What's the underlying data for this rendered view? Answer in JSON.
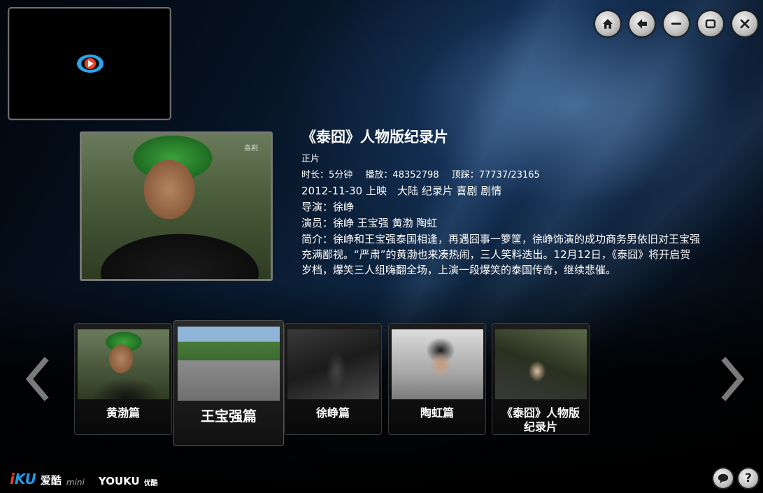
{
  "window": {
    "controls": [
      {
        "name": "home-button",
        "icon": "home-icon"
      },
      {
        "name": "back-button",
        "icon": "back-arrow-icon"
      },
      {
        "name": "minimize-button",
        "icon": "minimize-icon"
      },
      {
        "name": "maximize-button",
        "icon": "maximize-icon"
      },
      {
        "name": "close-button",
        "icon": "close-icon"
      }
    ]
  },
  "mini_player": {
    "icon": "youku-play-logo-icon"
  },
  "poster": {
    "stamp": "喜剧"
  },
  "detail": {
    "title": "《泰囧》人物版纪录片",
    "category": "正片",
    "duration": "时长：5分钟",
    "plays": "播放：48352798",
    "votes": "顶踩：77737/23165",
    "release_line": "2012-11-30 上映　大陆 纪录片 喜剧 剧情",
    "director": "导演：徐峥",
    "cast": "演员：徐峥 王宝强 黄渤 陶虹",
    "synopsis": "简介：徐峥和王宝强泰国相逢，再遇囧事一箩筐，徐峥饰演的成功商务男依旧对王宝强充满鄙视。“严肃”的黄渤也来凑热闹，三人笑料迭出。12月12日，《泰囧》将开启贺岁档，爆笑三人组嗨翻全场，上演一段爆笑的泰国传奇，继续悲催。"
  },
  "episodes": [
    {
      "label": "黄渤篇",
      "active": false
    },
    {
      "label": "王宝强篇",
      "active": true
    },
    {
      "label": "徐峥篇",
      "active": false
    },
    {
      "label": "陶虹篇",
      "active": false
    },
    {
      "label": "《泰囧》人物版\n纪录片",
      "active": false
    }
  ],
  "footer": {
    "brand_iku": "KU",
    "brand_iku_i": "i",
    "brand_cn": "爱酷",
    "brand_mini": "mini",
    "youku": "YOUKU",
    "youku_cn": "优酷",
    "buttons": [
      {
        "name": "feedback-button",
        "icon": "chat-bubble-icon"
      },
      {
        "name": "help-button",
        "label": "?"
      }
    ]
  },
  "colors": {
    "accent_blue": "#1e9be8",
    "accent_red": "#e8452c"
  }
}
